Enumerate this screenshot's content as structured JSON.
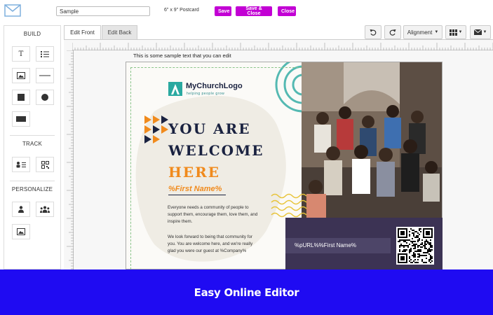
{
  "toolbar": {
    "design_name": "Sample",
    "size_label": "6\" x 9\" Postcard",
    "save_label": "Save",
    "save_close_label": "Save & Close",
    "close_label": "Close"
  },
  "left_panel": {
    "build_title": "BUILD",
    "build_tools": [
      "text-tool-icon",
      "list-tool-icon",
      "image-tool-icon",
      "line-tool-icon",
      "square-tool-icon",
      "circle-tool-icon",
      "rectangle-tool-icon"
    ],
    "track_title": "TRACK",
    "track_tools": [
      "contact-card-icon",
      "qr-code-icon"
    ],
    "personalize_title": "PERSONALIZE",
    "personalize_tools": [
      "person-icon",
      "group-icon",
      "image-icon"
    ]
  },
  "tabs": [
    {
      "label": "Edit Front",
      "active": true
    },
    {
      "label": "Edit Back",
      "active": false
    }
  ],
  "right_toolbar": {
    "undo_icon": "undo-icon",
    "redo_icon": "redo-icon",
    "alignment_label": "Alignment",
    "grid_icon": "grid-icon",
    "mail_icon": "mail-icon"
  },
  "canvas": {
    "sample_text": "This is some sample text that you can edit"
  },
  "postcard": {
    "logo_text": "MyChurchLogo",
    "logo_tagline": "helping people grow",
    "headline_1": "YOU ARE",
    "headline_2": "WELCOME",
    "headline_3": "HERE",
    "first_name_token": "%First Name%",
    "body_1": "Everyone needs a community of people to support them, encourage them, love them, and inspire them.",
    "body_2": "We look forward to being that community for you. You are welcome here, and we're really glad you were our guest at %Company%",
    "url_token": "%pURL%%First Name%"
  },
  "banner": {
    "text": "Easy Online Editor"
  },
  "colors": {
    "accent_purple": "#c200d4",
    "banner_blue": "#1f0bf2",
    "navy": "#1a2240",
    "orange": "#f08a1c",
    "teal": "#2aa9a0",
    "card_purple": "#3c3354"
  }
}
